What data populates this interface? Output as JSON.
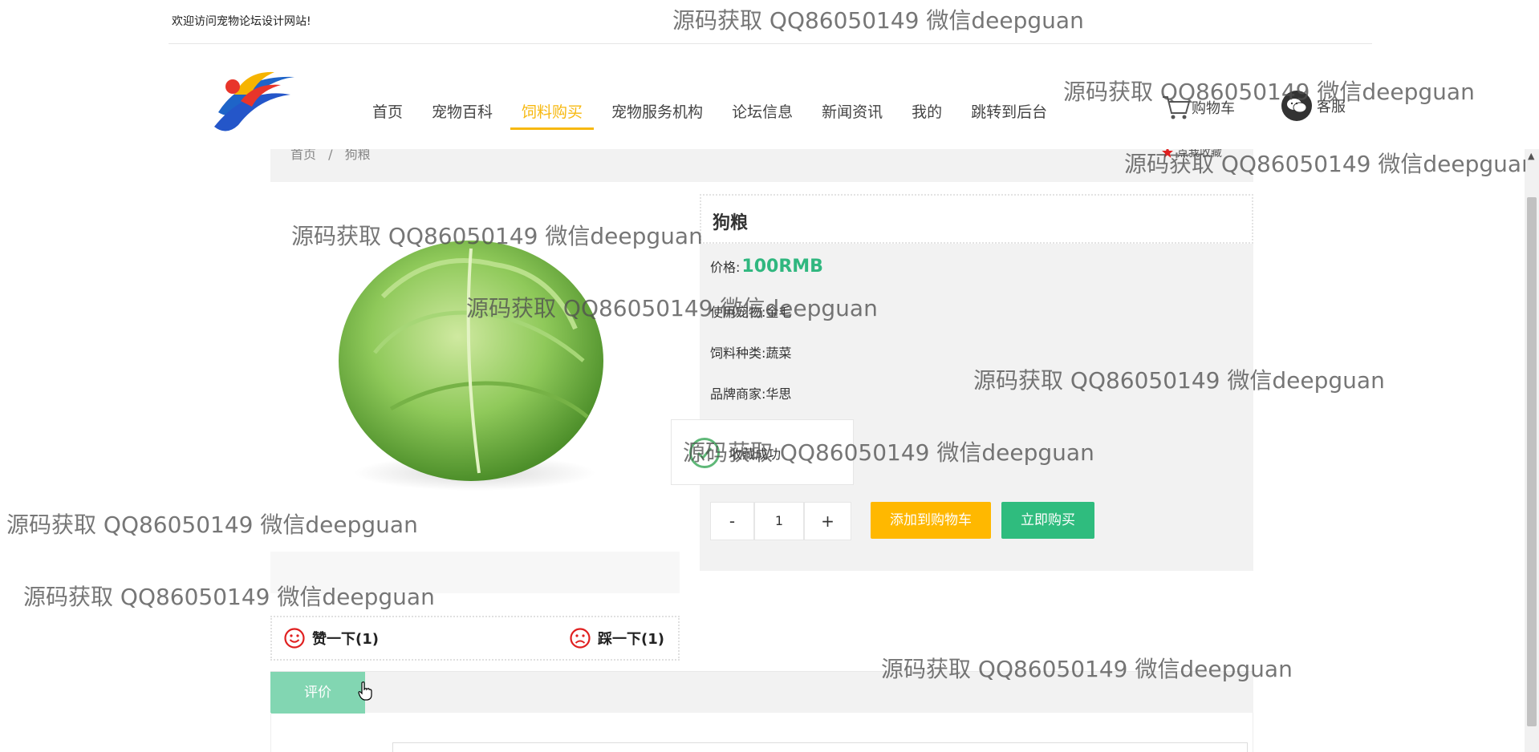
{
  "topbar": {
    "welcome": "欢迎访问宠物论坛设计网站!"
  },
  "nav": {
    "items": [
      {
        "label": "首页",
        "active": false
      },
      {
        "label": "宠物百科",
        "active": false
      },
      {
        "label": "饲料购买",
        "active": true
      },
      {
        "label": "宠物服务机构",
        "active": false
      },
      {
        "label": "论坛信息",
        "active": false
      },
      {
        "label": "新闻资讯",
        "active": false
      },
      {
        "label": "我的",
        "active": false
      },
      {
        "label": "跳转到后台",
        "active": false
      }
    ],
    "cart_label": "购物车",
    "service_label": "客服"
  },
  "breadcrumb": {
    "home": "首页",
    "separator": "/",
    "current": "狗粮",
    "collect_label": "点我收藏"
  },
  "product": {
    "title": "狗粮",
    "price_label": "价格:",
    "price_value": "100RMB",
    "fields": [
      {
        "label": "使用宠物:",
        "value": "金毛"
      },
      {
        "label": "饲料种类:",
        "value": "蔬菜"
      },
      {
        "label": "品牌商家:",
        "value": "华思"
      }
    ],
    "quantity": "1",
    "minus_label": "-",
    "plus_label": "+",
    "add_to_cart_label": "添加到购物车",
    "buy_now_label": "立即购买"
  },
  "toast": {
    "text": "收藏成功"
  },
  "votes": {
    "like_label": "赞一下(1)",
    "dislike_label": "踩一下(1)"
  },
  "tabs": {
    "review_label": "评价"
  },
  "colors": {
    "accent": "#f7b80f",
    "green": "#30b77f",
    "buy_button": "#2fbc7e",
    "cart_button": "#ffb800",
    "tab_active": "#82d6b2",
    "vote_red": "#e02020"
  },
  "watermark_text": "源码获取 QQ86050149 微信deepguan"
}
